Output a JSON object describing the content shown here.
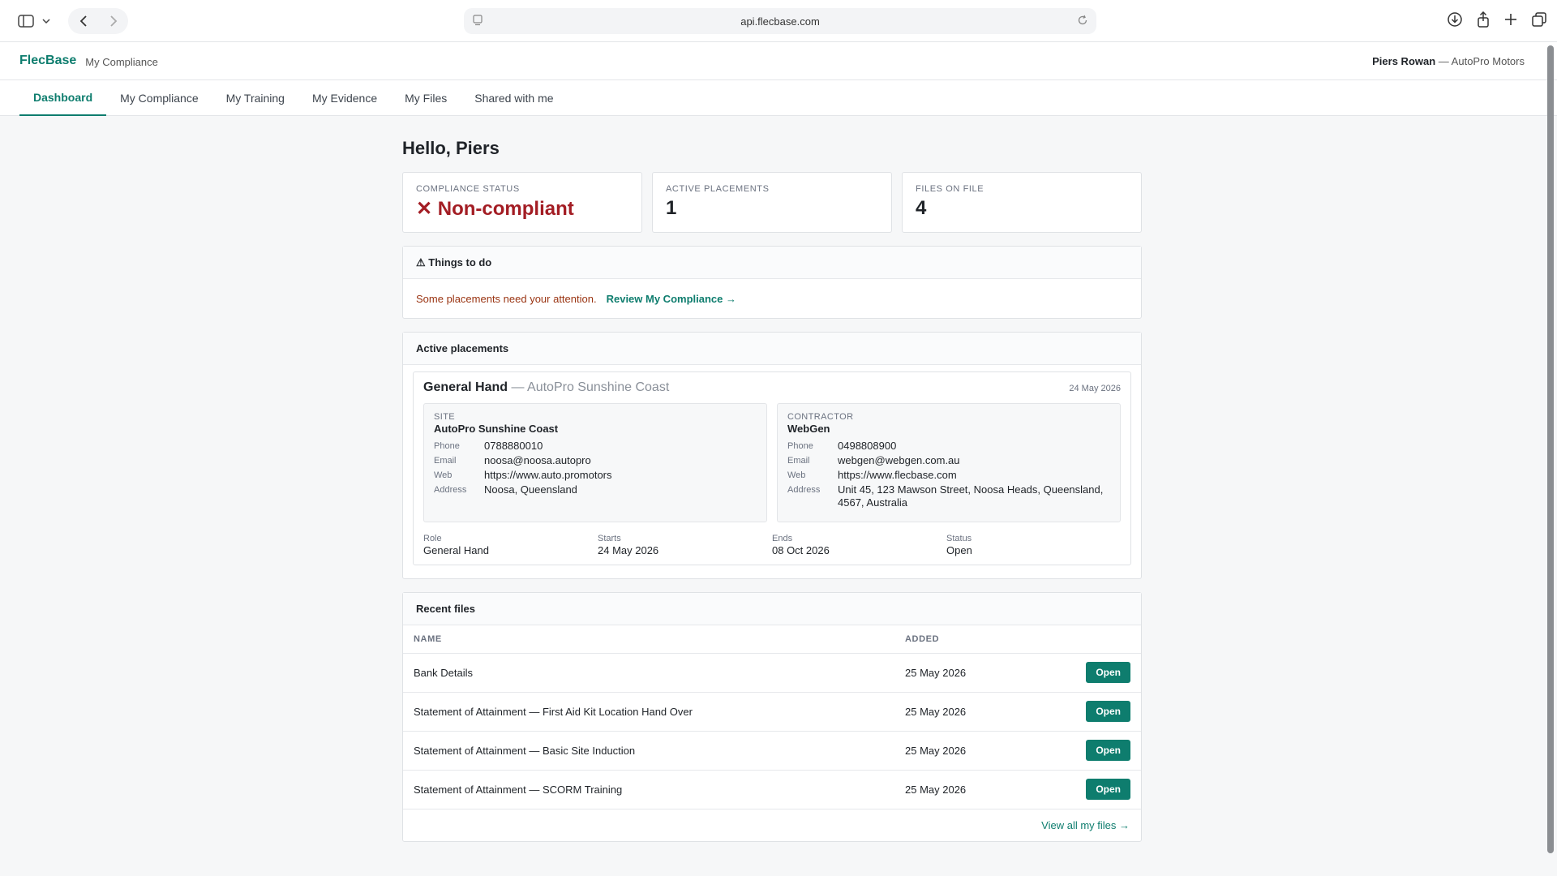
{
  "browser": {
    "url": "api.flecbase.com"
  },
  "app": {
    "brand": "FlecBase",
    "brand_sub": "My Compliance",
    "user_name": "Piers Rowan",
    "user_org": " — AutoPro Motors"
  },
  "tabs": [
    {
      "label": "Dashboard",
      "active": true
    },
    {
      "label": "My Compliance"
    },
    {
      "label": "My Training"
    },
    {
      "label": "My Evidence"
    },
    {
      "label": "My Files"
    },
    {
      "label": "Shared with me"
    }
  ],
  "greeting": "Hello, Piers",
  "cards": [
    {
      "label": "Compliance status",
      "value": "✕ Non-compliant"
    },
    {
      "label": "Active placements",
      "value": "1"
    },
    {
      "label": "Files on file",
      "value": "4"
    }
  ],
  "todo": {
    "title": "⚠ Things to do",
    "text": "Some placements need your attention.",
    "link": "Review My Compliance →"
  },
  "placements": {
    "title": "Active placements",
    "item": {
      "role_title": "General Hand",
      "separator": " — AutoPro Sunshine Coast",
      "date": "24 May 2026",
      "site": {
        "kicker": "Site",
        "name": "AutoPro Sunshine Coast",
        "rows": [
          {
            "k": "Phone",
            "v": "0788880010"
          },
          {
            "k": "Email",
            "v": "noosa@noosa.autopro"
          },
          {
            "k": "Web",
            "v": "https://www.auto.promotors"
          },
          {
            "k": "Address",
            "v": "Noosa, Queensland"
          }
        ]
      },
      "contractor": {
        "kicker": "Contractor",
        "name": "WebGen",
        "rows": [
          {
            "k": "Phone",
            "v": "0498808900"
          },
          {
            "k": "Email",
            "v": "webgen@webgen.com.au"
          },
          {
            "k": "Web",
            "v": "https://www.flecbase.com"
          },
          {
            "k": "Address",
            "v": "Unit 45, 123 Mawson Street, Noosa Heads, Queensland, 4567, Australia"
          }
        ]
      },
      "meta": [
        {
          "k": "Role",
          "v": "General Hand"
        },
        {
          "k": "Starts",
          "v": "24 May 2026"
        },
        {
          "k": "Ends",
          "v": "08 Oct 2026"
        },
        {
          "k": "Status",
          "v": "Open"
        }
      ]
    }
  },
  "recent_files": {
    "title": "Recent files",
    "col_name": "Name",
    "col_added": "Added",
    "open_label": "Open",
    "rows": [
      {
        "name": "Bank Details",
        "added": "25 May 2026"
      },
      {
        "name": "Statement of Attainment — First Aid Kit Location Hand Over",
        "added": "25 May 2026"
      },
      {
        "name": "Statement of Attainment — Basic Site Induction",
        "added": "25 May 2026"
      },
      {
        "name": "Statement of Attainment — SCORM Training",
        "added": "25 May 2026"
      }
    ],
    "view_all": "View all my files →"
  }
}
